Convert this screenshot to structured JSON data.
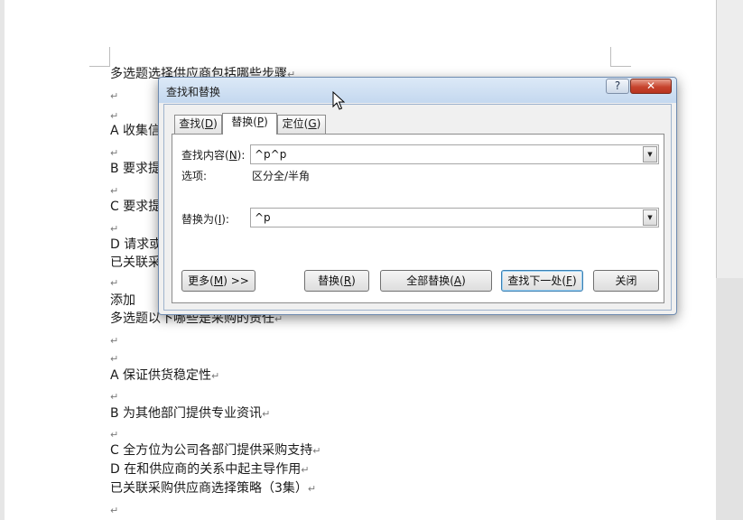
{
  "document": {
    "lines": [
      {
        "text": "多选题选择供应商包括哪些步骤",
        "para": true
      },
      {
        "text": "",
        "para": true
      },
      {
        "text": "",
        "para": true
      },
      {
        "text": "A 收集信",
        "para": false
      },
      {
        "text": "",
        "para": true
      },
      {
        "text": "B 要求提",
        "para": false
      },
      {
        "text": "",
        "para": true
      },
      {
        "text": "C 要求提",
        "para": false
      },
      {
        "text": "",
        "para": true
      },
      {
        "text": "D 请求或",
        "para": false
      },
      {
        "text": "已关联采",
        "para": false
      },
      {
        "text": "",
        "para": true
      },
      {
        "text": "添加",
        "para": false
      },
      {
        "text": "多选题以下哪些是采购的责任",
        "para": true
      },
      {
        "text": "",
        "para": true
      },
      {
        "text": "",
        "para": true
      },
      {
        "text": "A 保证供货稳定性",
        "para": true
      },
      {
        "text": "",
        "para": true
      },
      {
        "text": "B 为其他部门提供专业资讯",
        "para": true
      },
      {
        "text": "",
        "para": true
      },
      {
        "text": "C 全方位为公司各部门提供采购支持",
        "para": true
      },
      {
        "text": "D 在和供应商的关系中起主导作用",
        "para": true
      },
      {
        "text": "已关联采购供应商选择策略（3集）",
        "para": true
      },
      {
        "text": "",
        "para": true
      }
    ],
    "para_mark": "↵"
  },
  "dialog": {
    "title": "查找和替换",
    "help_glyph": "?",
    "close_glyph": "✕",
    "tabs": [
      {
        "pre": "查找(",
        "key": "D",
        "post": ")"
      },
      {
        "pre": "替换(",
        "key": "P",
        "post": ")"
      },
      {
        "pre": "定位(",
        "key": "G",
        "post": ")"
      }
    ],
    "find_label": {
      "pre": "查找内容(",
      "key": "N",
      "post": "):"
    },
    "find_value": "^p^p",
    "options_label": "选项:",
    "options_value": "区分全/半角",
    "replace_label": {
      "pre": "替换为(",
      "key": "I",
      "post": "):"
    },
    "replace_value": "^p",
    "buttons": {
      "more": {
        "pre": "更多(",
        "key": "M",
        "post": ") >>"
      },
      "replace": {
        "pre": "替换(",
        "key": "R",
        "post": ")"
      },
      "replace_all": {
        "pre": "全部替换(",
        "key": "A",
        "post": ")"
      },
      "find_next": {
        "pre": "查找下一处(",
        "key": "F",
        "post": ")"
      },
      "close": "关闭"
    },
    "combo_arrow": "▼"
  }
}
